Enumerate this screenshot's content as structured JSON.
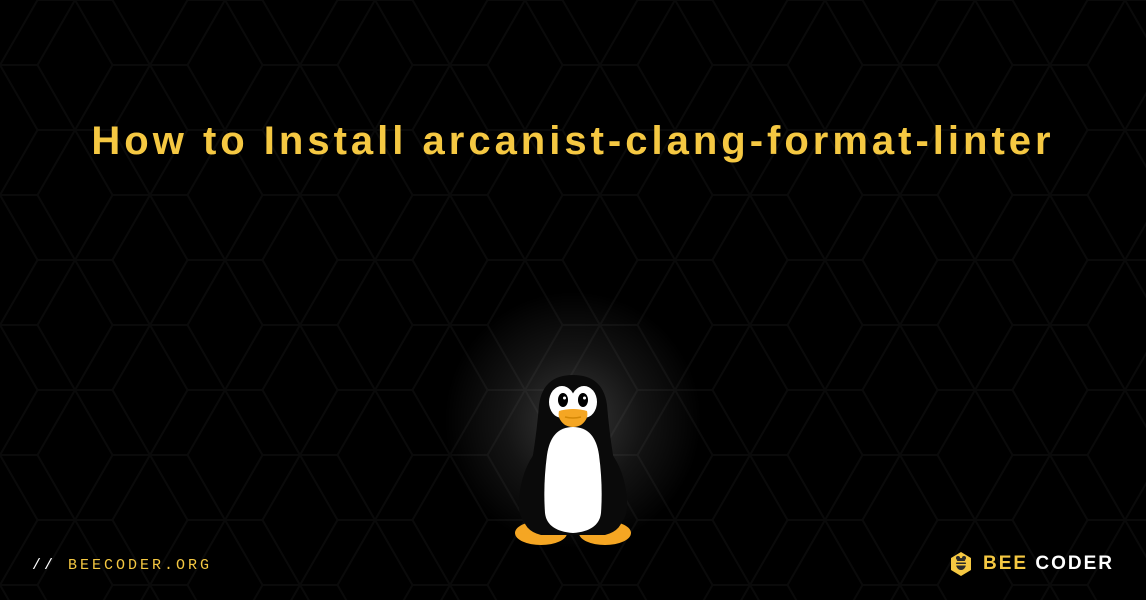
{
  "title": "How to Install arcanist-clang-format-linter",
  "site_url": "BEECODER.ORG",
  "brand_bee": "BEE",
  "brand_coder": " CODER",
  "icons": {
    "penguin": "tux-penguin",
    "brand_logo": "bee-hexagon-icon"
  },
  "colors": {
    "accent": "#f5c842",
    "background": "#000000",
    "text_light": "#ffffff"
  }
}
